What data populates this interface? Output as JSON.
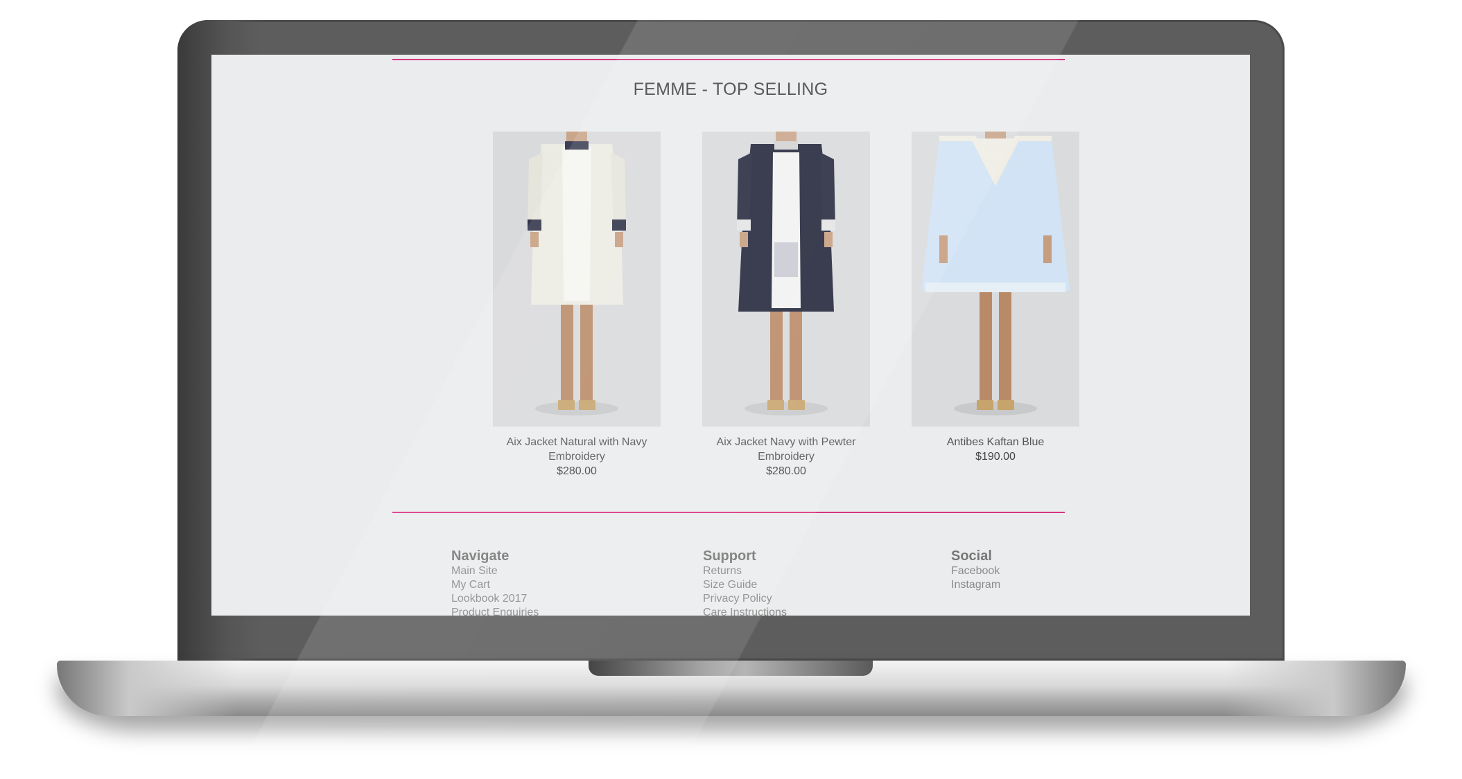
{
  "page": {
    "section_title": "FEMME - TOP SELLING"
  },
  "products": [
    {
      "name": "Aix Jacket Natural with Navy Embroidery",
      "price": "$280.00",
      "image": "cream jacket on model"
    },
    {
      "name": "Aix Jacket Navy with Pewter Embroidery",
      "price": "$280.00",
      "image": "navy jacket on model"
    },
    {
      "name": "Antibes Kaftan Blue",
      "price": "$190.00",
      "image": "light blue kaftan on model"
    }
  ],
  "footer": {
    "navigate": {
      "heading": "Navigate",
      "links": [
        "Main Site",
        "My Cart",
        "Lookbook 2017",
        "Product Enquiries"
      ]
    },
    "support": {
      "heading": "Support",
      "links": [
        "Returns",
        "Size Guide",
        "Privacy Policy",
        "Care Instructions"
      ]
    },
    "social": {
      "heading": "Social",
      "links": [
        "Facebook",
        "Instagram"
      ]
    }
  },
  "colors": {
    "accent_rule": "#d6357f",
    "screen_background": "#ebeced",
    "laptop_bezel": "#5d5d5d"
  }
}
